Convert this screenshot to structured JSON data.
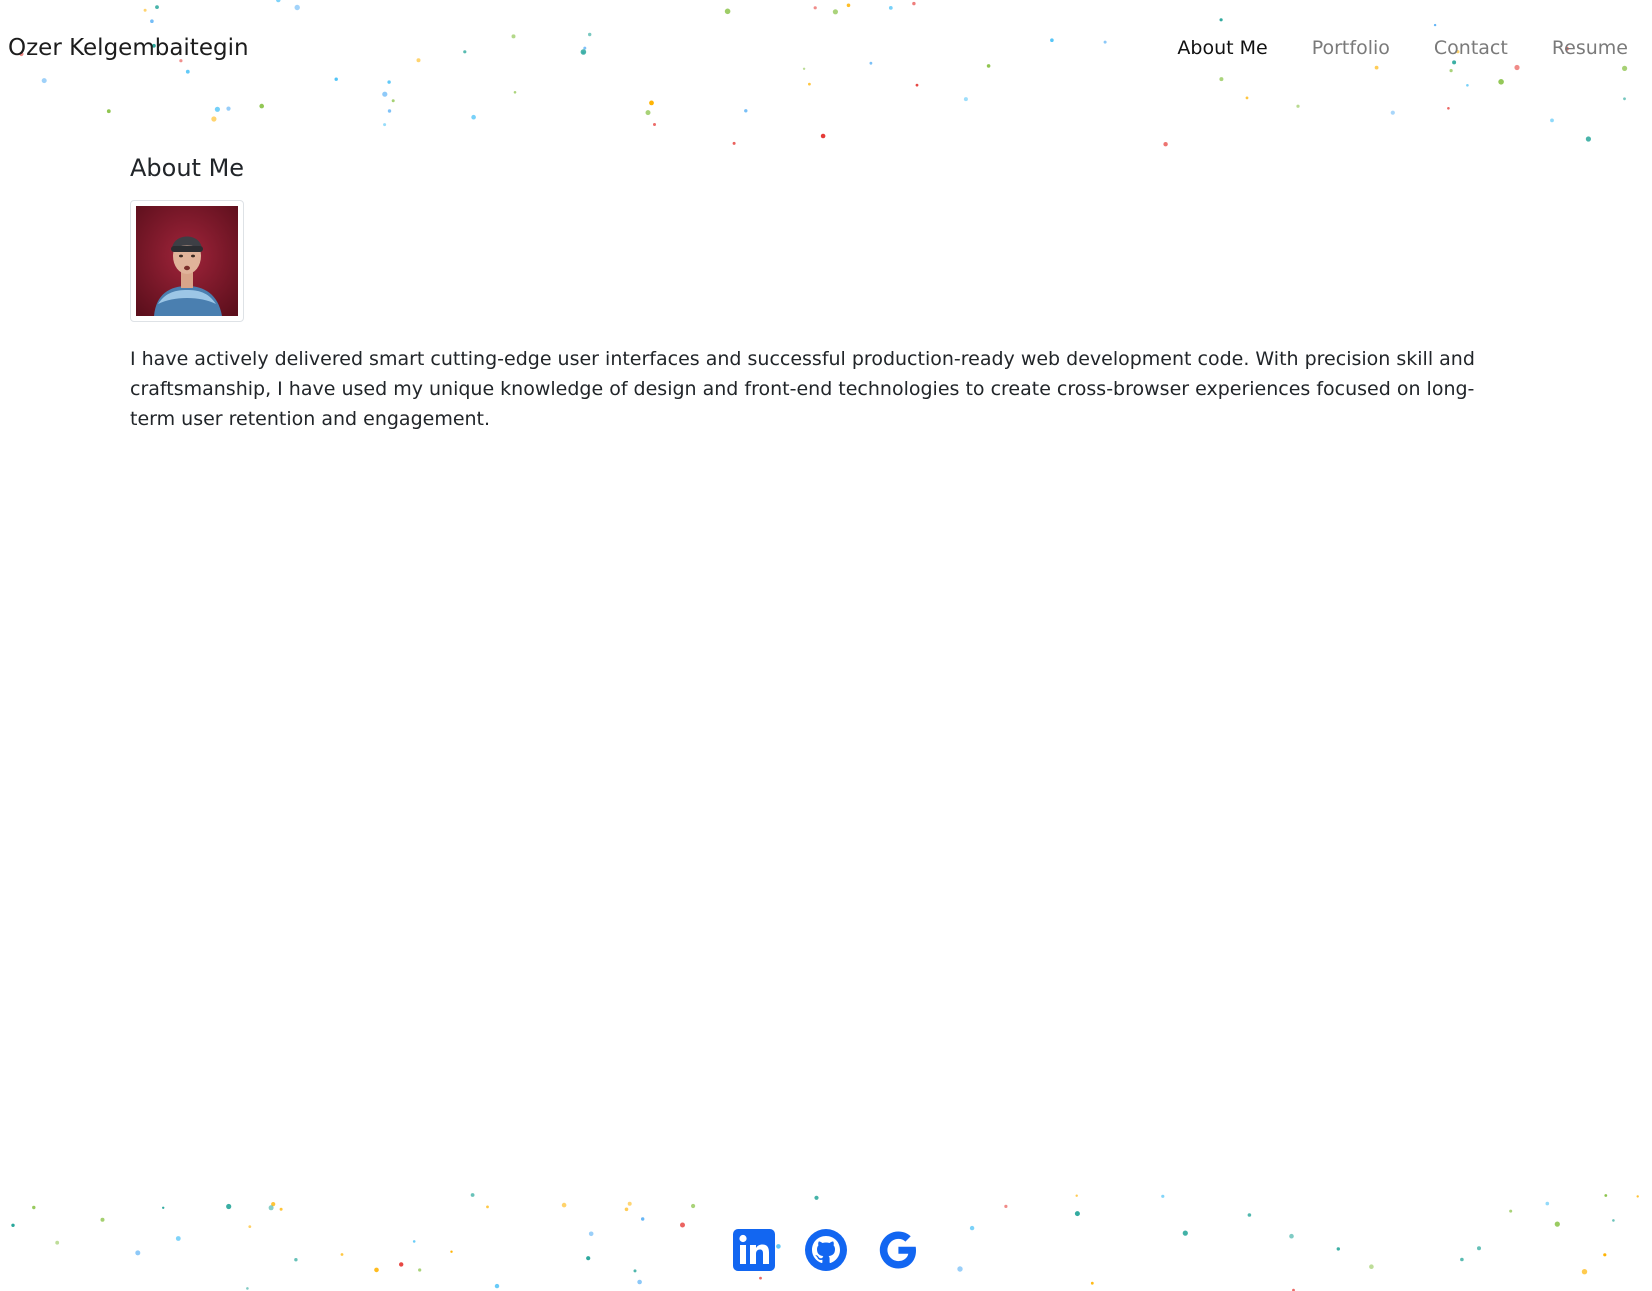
{
  "header": {
    "brand": "Ozer Kelgembaitegin",
    "nav": [
      {
        "label": "About Me",
        "active": true
      },
      {
        "label": "Portfolio",
        "active": false
      },
      {
        "label": "Contact",
        "active": false
      },
      {
        "label": "Resume",
        "active": false
      }
    ]
  },
  "main": {
    "title": "About Me",
    "avatar_icon": "profile-photo",
    "about_text": "I have actively delivered smart cutting-edge user interfaces and successful production-ready web development code. With precision skill and craftsmanship, I have used my unique knowledge of design and front-end technologies to create cross-browser experiences focused on long-term user retention and engagement."
  },
  "footer": {
    "social": [
      {
        "icon": "linkedin-icon"
      },
      {
        "icon": "github-icon"
      },
      {
        "icon": "google-icon"
      }
    ]
  },
  "colors": {
    "accent": "#1266f1",
    "confetti": [
      "#4fc3f7",
      "#ffb300",
      "#e53935",
      "#8bc34a",
      "#26a69a",
      "#64b5f6"
    ]
  }
}
